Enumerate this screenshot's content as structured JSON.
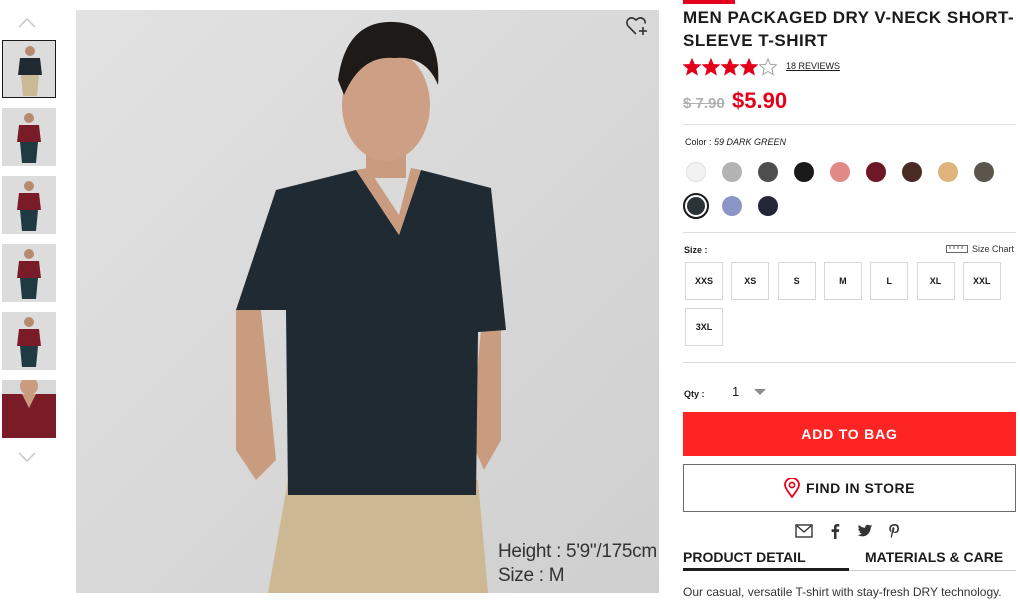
{
  "thumbnails": {
    "count": 6,
    "selected_index": 0,
    "shirt_colors": [
      "#1f2a33",
      "#7a1c28",
      "#7a1c28",
      "#7a1c28",
      "#7a1c28",
      "#7a1c28"
    ]
  },
  "main_image": {
    "caption_height": "Height : 5'9\"/175cm",
    "caption_size": "Size : M"
  },
  "product": {
    "title": "MEN PACKAGED DRY V-NECK SHORT-SLEEVE T-SHIRT",
    "rating": 4,
    "rating_max": 5,
    "reviews_label": "18 REVIEWS",
    "old_price": "$ 7.90",
    "new_price": "$5.90"
  },
  "color": {
    "label": "Color :",
    "selected_name": "59 DARK GREEN",
    "swatches": [
      "#f2f2f2",
      "#b3b3b3",
      "#4e4e4e",
      "#1a1a1a",
      "#e08a86",
      "#6e1726",
      "#4a2a22",
      "#dfb47a",
      "#5c554c",
      "#2a3338",
      "#8a96c8",
      "#252538"
    ],
    "selected_index": 9
  },
  "size": {
    "label": "Size :",
    "chart_label": "Size Chart",
    "options": [
      "XXS",
      "XS",
      "S",
      "M",
      "L",
      "XL",
      "XXL",
      "3XL"
    ]
  },
  "quantity": {
    "label": "Qty :",
    "value": "1"
  },
  "actions": {
    "add_to_bag": "ADD TO BAG",
    "find_in_store": "FIND IN STORE"
  },
  "tabs": {
    "product_detail": "PRODUCT DETAIL",
    "materials_care": "MATERIALS & CARE"
  },
  "description": "Our casual, versatile T-shirt with stay-fresh DRY technology.",
  "colors": {
    "accent_red": "#ff2424",
    "price_red": "#e4001b"
  }
}
